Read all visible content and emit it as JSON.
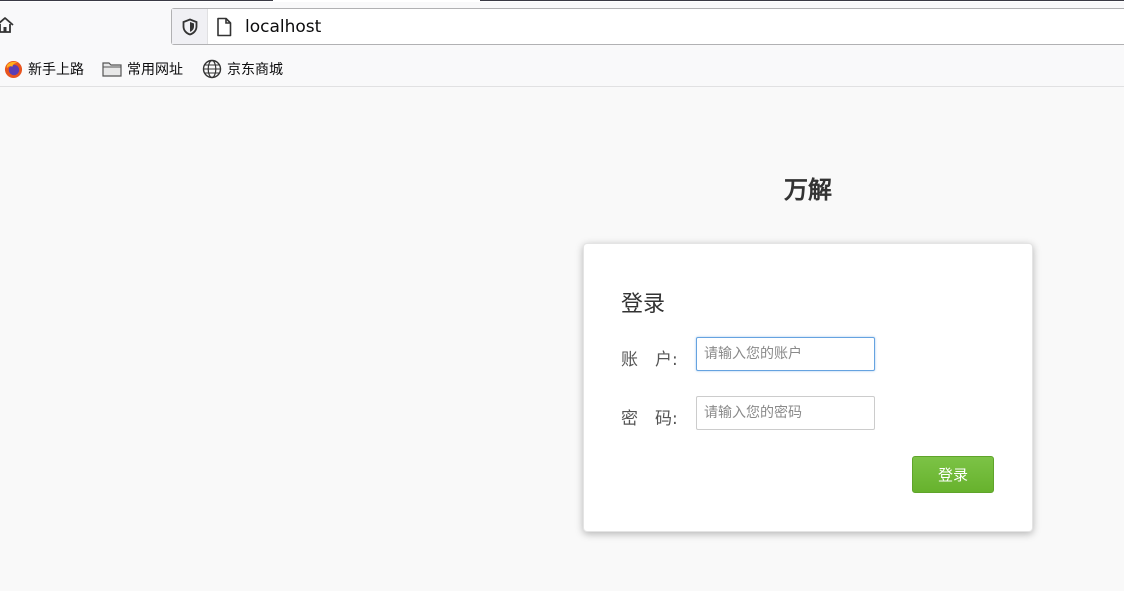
{
  "browser": {
    "url": "localhost",
    "bookmarks": [
      {
        "label": "新手上路",
        "icon": "firefox-icon"
      },
      {
        "label": "常用网址",
        "icon": "folder-icon"
      },
      {
        "label": "京东商城",
        "icon": "globe-icon"
      }
    ]
  },
  "page": {
    "brand": "万解",
    "login": {
      "title": "登录",
      "account_label": "账　户:",
      "account_placeholder": "请输入您的账户",
      "account_value": "",
      "password_label": "密　码:",
      "password_placeholder": "请输入您的密码",
      "password_value": "",
      "submit_label": "登录"
    }
  },
  "colors": {
    "button_green": "#6bb52f",
    "focus_blue": "#66a3e0"
  }
}
